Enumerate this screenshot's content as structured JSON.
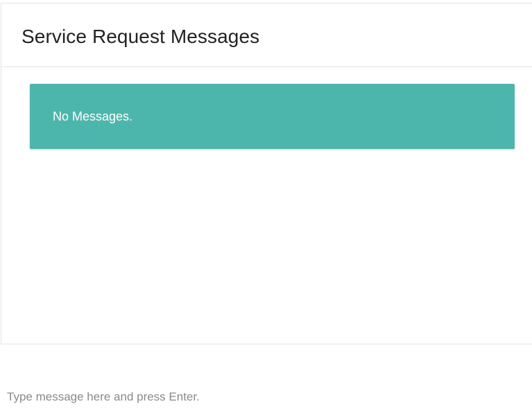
{
  "panel": {
    "title": "Service Request Messages"
  },
  "messages": {
    "empty_text": "No Messages.",
    "alert_color": "#4db6ac"
  },
  "composer": {
    "value": "",
    "placeholder": "Type message here and press Enter."
  }
}
